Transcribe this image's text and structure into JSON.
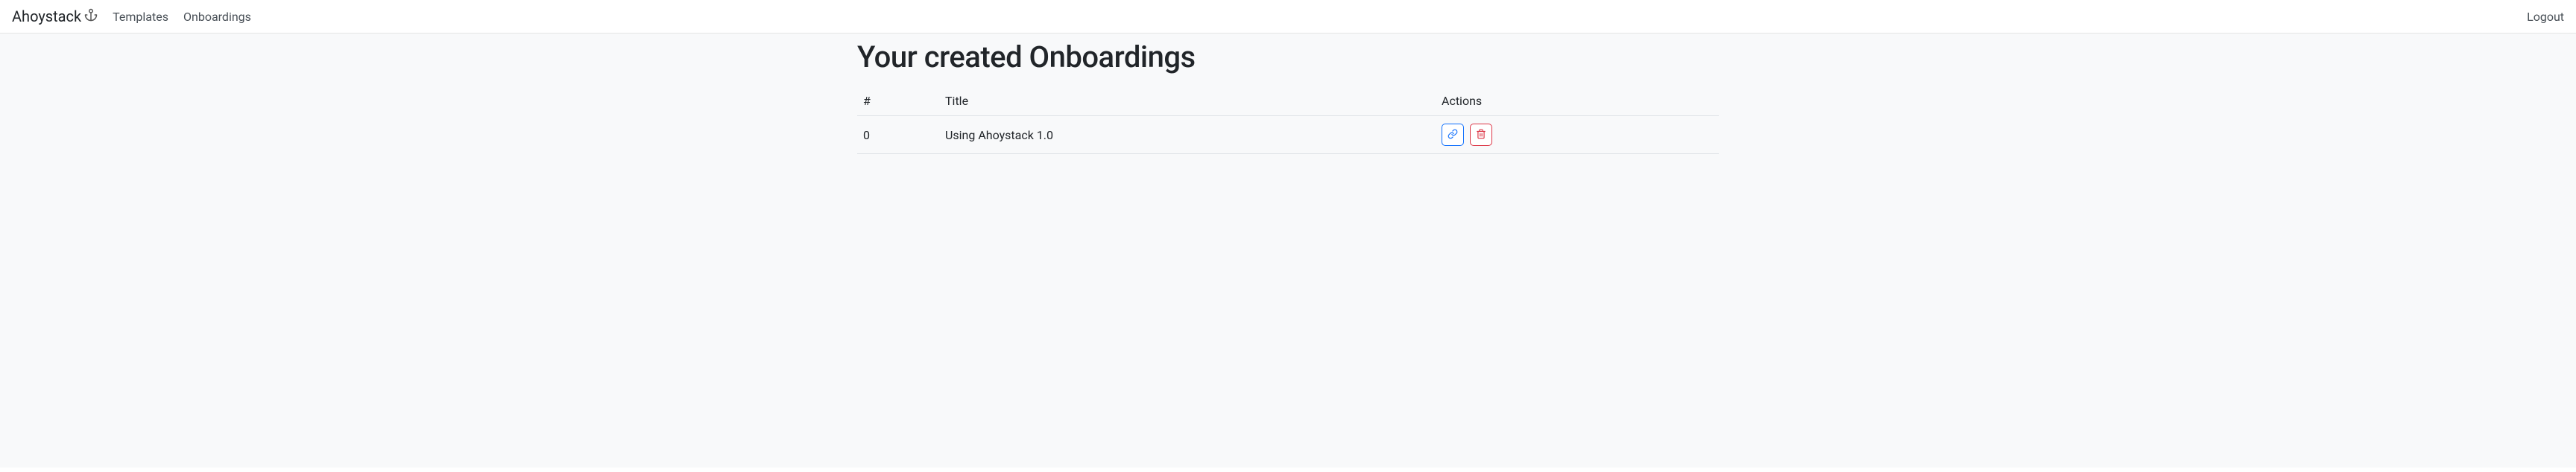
{
  "nav": {
    "brand": "Ahoystack",
    "links": [
      "Templates",
      "Onboardings"
    ],
    "logout": "Logout"
  },
  "page": {
    "title": "Your created Onboardings"
  },
  "table": {
    "headers": {
      "index": "#",
      "title": "Title",
      "actions": "Actions"
    },
    "rows": [
      {
        "index": "0",
        "title": "Using Ahoystack 1.0"
      }
    ]
  }
}
